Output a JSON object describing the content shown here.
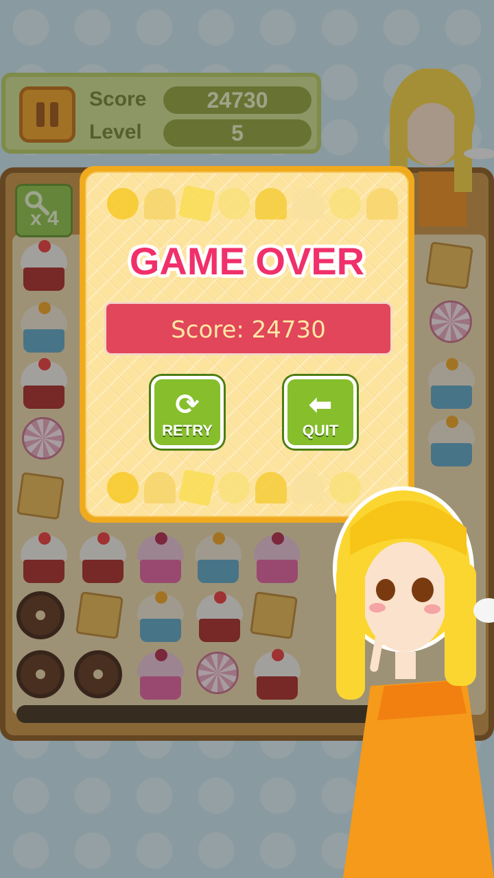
{
  "header": {
    "score_label": "Score",
    "score_value": "24730",
    "level_label": "Level",
    "level_value": "5"
  },
  "board": {
    "hint_count": "x 4"
  },
  "dialog": {
    "title": "GAME OVER",
    "score_text": "Score: 24730",
    "retry_label": "RETRY",
    "quit_label": "QUIT"
  },
  "icons": {
    "pause": "pause-icon",
    "hint": "magnifier-icon",
    "retry": "refresh-icon",
    "quit": "arrow-left-icon"
  },
  "colors": {
    "title": "#f0306a",
    "score_box": "#e2465a",
    "button": "#86be2c",
    "dialog_border": "#f0aa1e"
  }
}
